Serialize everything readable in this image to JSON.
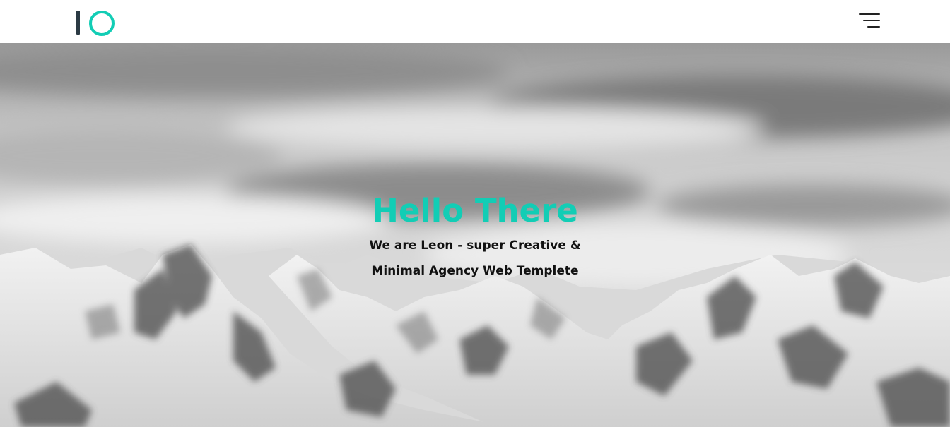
{
  "colors": {
    "accent": "#12cdb5",
    "logo_dark": "#2b3a44",
    "menu_lines": "#222222"
  },
  "header": {
    "logo_icon": "io-logo-icon",
    "menu_icon": "hamburger-menu-icon"
  },
  "hero": {
    "title": "Hello There",
    "subtitle": "We are Leon - super Creative & Minimal Agency Web Templete",
    "background": "snowy-mountains-grayscale-photo"
  }
}
